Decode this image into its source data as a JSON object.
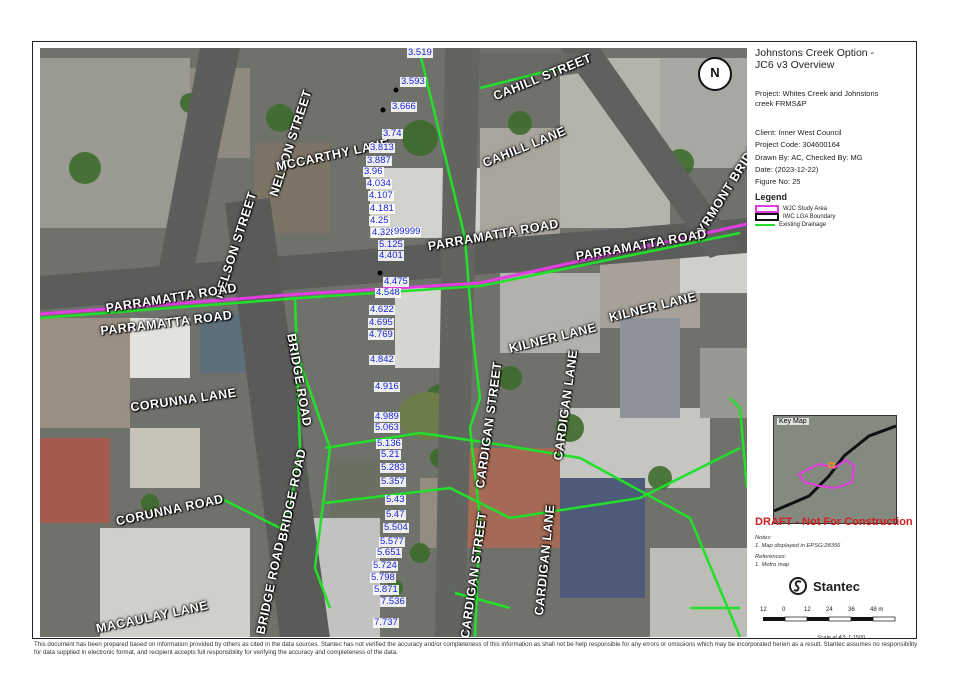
{
  "map": {
    "streets": [
      {
        "id": "nelson-street-1",
        "text": "NELSON STREET"
      },
      {
        "id": "nelson-street-2",
        "text": "NELSON STREET"
      },
      {
        "id": "mccarthy-lane",
        "text": "MCCARTHY LANE"
      },
      {
        "id": "cahill-street",
        "text": "CAHILL STREET"
      },
      {
        "id": "cahill-lane",
        "text": "CAHILL LANE"
      },
      {
        "id": "pyrmont-bridge-road",
        "text": "PYRMONT BRIDGE ROAD"
      },
      {
        "id": "parramatta-road-1",
        "text": "PARRAMATTA ROAD"
      },
      {
        "id": "parramatta-road-2",
        "text": "PARRAMATTA ROAD"
      },
      {
        "id": "parramatta-road-3",
        "text": "PARRAMATTA ROAD"
      },
      {
        "id": "parramatta-road-4",
        "text": "PARRAMATTA ROAD"
      },
      {
        "id": "kilner-lane-1",
        "text": "KILNER LANE"
      },
      {
        "id": "kilner-lane-2",
        "text": "KILNER LANE"
      },
      {
        "id": "bridge-road-1",
        "text": "BRIDGE ROAD"
      },
      {
        "id": "bridge-road-2",
        "text": "BRIDGE ROAD"
      },
      {
        "id": "bridge-road-3",
        "text": "BRIDGE ROAD"
      },
      {
        "id": "corunna-lane",
        "text": "CORUNNA LANE"
      },
      {
        "id": "corunna-road",
        "text": "CORUNNA ROAD"
      },
      {
        "id": "cardigan-street-1",
        "text": "CARDIGAN STREET"
      },
      {
        "id": "cardigan-street-2",
        "text": "CARDIGAN STREET"
      },
      {
        "id": "cardigan-lane-1",
        "text": "CARDIGAN LANE"
      },
      {
        "id": "cardigan-lane-2",
        "text": "CARDIGAN LANE"
      },
      {
        "id": "macaulay-lane",
        "text": "MACAULAY LANE"
      }
    ],
    "levels": [
      "3.519",
      "3.593",
      "3.666",
      "3.74",
      "3.813",
      "3.887",
      "3.96",
      "4.034",
      "4.107",
      "4.181",
      "4.25",
      "4.328",
      "99999",
      "5.125",
      "4.401",
      "4.475",
      "4.548",
      "4.622",
      "4.695",
      "4.769",
      "4.842",
      "4.916",
      "4.989",
      "5.063",
      "5.136",
      "5.21",
      "5.283",
      "5.357",
      "5.43",
      "5.47",
      "5.504",
      "5.577",
      "5.651",
      "5.724",
      "5.798",
      "5.871",
      "7.536",
      "7.737"
    ],
    "north_label": "N"
  },
  "panel": {
    "title_lines": [
      "Johnstons Creek Option -",
      "JC6 v3 Overview"
    ],
    "project_lines": [
      "Project:  Whites  Creek  and  Johnstons",
      "creek FRMS&P"
    ],
    "client": "Client:  Inner West Council",
    "project_code": "Project Code:  304600164",
    "drawn_by": "Drawn By:  AC, Checked By: MG",
    "date": "Date:  (2023-12-22)",
    "figure_no": "Figure No:  25",
    "legend_title": "Legend",
    "legend_items": [
      {
        "label": "WJC Study Area",
        "color": "#e23de0"
      },
      {
        "label": "IWC LGA Boundary",
        "color": "#111111"
      },
      {
        "label": "Existing Drainage",
        "color": "#22e02a"
      }
    ],
    "keymap_label": "Key Map",
    "draft": "DRAFT - Not For Construction",
    "notes_title": "Notes:",
    "notes": "1. Map displayed in EPSG:28356",
    "references_title": "References:",
    "references": "1. Metro map",
    "brand": "Stantec",
    "scale_ticks": [
      "12",
      "0",
      "12",
      "24",
      "36",
      "48 m"
    ],
    "scale_text": "Scale at A3: 1:1500"
  },
  "disclaimer": "This document has been prepared based on information provided by others as cited in the data sources. Stantec has not verified the accuracy and/or completeness of this information as shall not be help responsible for any errors or omissions which may be incorporated herein as a result. Stantec assumes no responsibility for data supplied in electronic format, and recipient accepts full responsibility for verifying the accuracy and completeness of the data.",
  "colors": {
    "study_area": "#e23de0",
    "drainage": "#22e02a",
    "labels": "#1b25d8",
    "draft": "#d21f1f"
  }
}
